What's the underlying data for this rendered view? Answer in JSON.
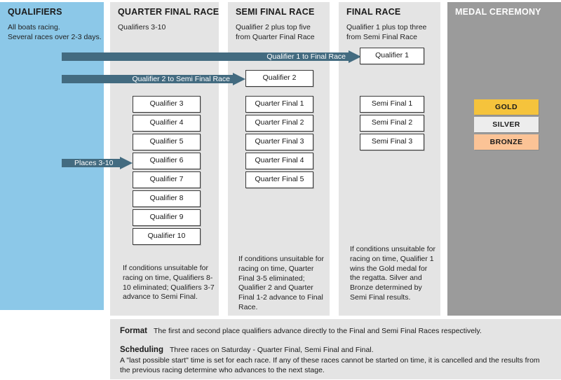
{
  "colors": {
    "qualifiers_bg": "#8cc8e8",
    "stage_bg": "#e4e4e4",
    "medal_bg": "#9b9b9b",
    "arrow": "#436b80",
    "gold": "#f5c33c",
    "silver": "#ededed",
    "bronze": "#fbc396"
  },
  "columns": {
    "qualifiers": {
      "title": "QUALIFIERS",
      "subtitle": "All boats racing.\nSeveral races over 2-3 days."
    },
    "quarter_final": {
      "title": "QUARTER FINAL RACE",
      "subtitle": "Qualifiers 3-10",
      "boxes": [
        "Qualifier 3",
        "Qualifier 4",
        "Qualifier 5",
        "Qualifier 6",
        "Qualifier 7",
        "Qualifier 8",
        "Qualifier 9",
        "Qualifier 10"
      ],
      "note": "If conditions unsuitable for racing on time, Qualifiers 8-10 eliminated; Qualifiers 3-7 advance to Semi Final."
    },
    "semi_final": {
      "title": "SEMI FINAL RACE",
      "subtitle": "Qualifier 2 plus top five\nfrom Quarter Final Race",
      "seeded_box": "Qualifier 2",
      "boxes": [
        "Quarter Final 1",
        "Quarter Final 2",
        "Quarter Final 3",
        "Quarter Final 4",
        "Quarter Final 5"
      ],
      "note": "If conditions unsuitable for racing on time, Quarter Final 3-5 eliminated; Qualifier 2 and Quarter Final 1-2 advance to Final Race."
    },
    "final": {
      "title": "FINAL RACE",
      "subtitle": "Qualifier 1 plus top three\nfrom Semi Final Race",
      "seeded_box": "Qualifier 1",
      "boxes": [
        "Semi Final 1",
        "Semi Final 2",
        "Semi Final 3"
      ],
      "note": "If conditions unsuitable for racing on time, Qualifier 1 wins the Gold medal for the regatta. Silver and Bronze determined by Semi Final results."
    },
    "medal_ceremony": {
      "title": "MEDAL CEREMONY",
      "medals": [
        {
          "label": "GOLD",
          "color": "#f5c33c"
        },
        {
          "label": "SILVER",
          "color": "#ededed"
        },
        {
          "label": "BRONZE",
          "color": "#fbc396"
        }
      ]
    }
  },
  "arrows": [
    {
      "label": "Qualifier 1 to Final Race"
    },
    {
      "label": "Qualifier 2 to Semi Final Race"
    },
    {
      "label": "Places 3-10"
    }
  ],
  "bottom_panel": {
    "format_heading": "Format",
    "format_text": "The first and second place qualifiers advance directly to the Final and Semi Final Races respectively.",
    "scheduling_heading": "Scheduling",
    "scheduling_text": "Three races on Saturday - Quarter Final, Semi Final and Final.",
    "scheduling_detail": "A \"last possible start\" time is set for each race. If any of these races cannot be started on time, it is cancelled and the results from the previous racing determine who advances to the next stage."
  }
}
